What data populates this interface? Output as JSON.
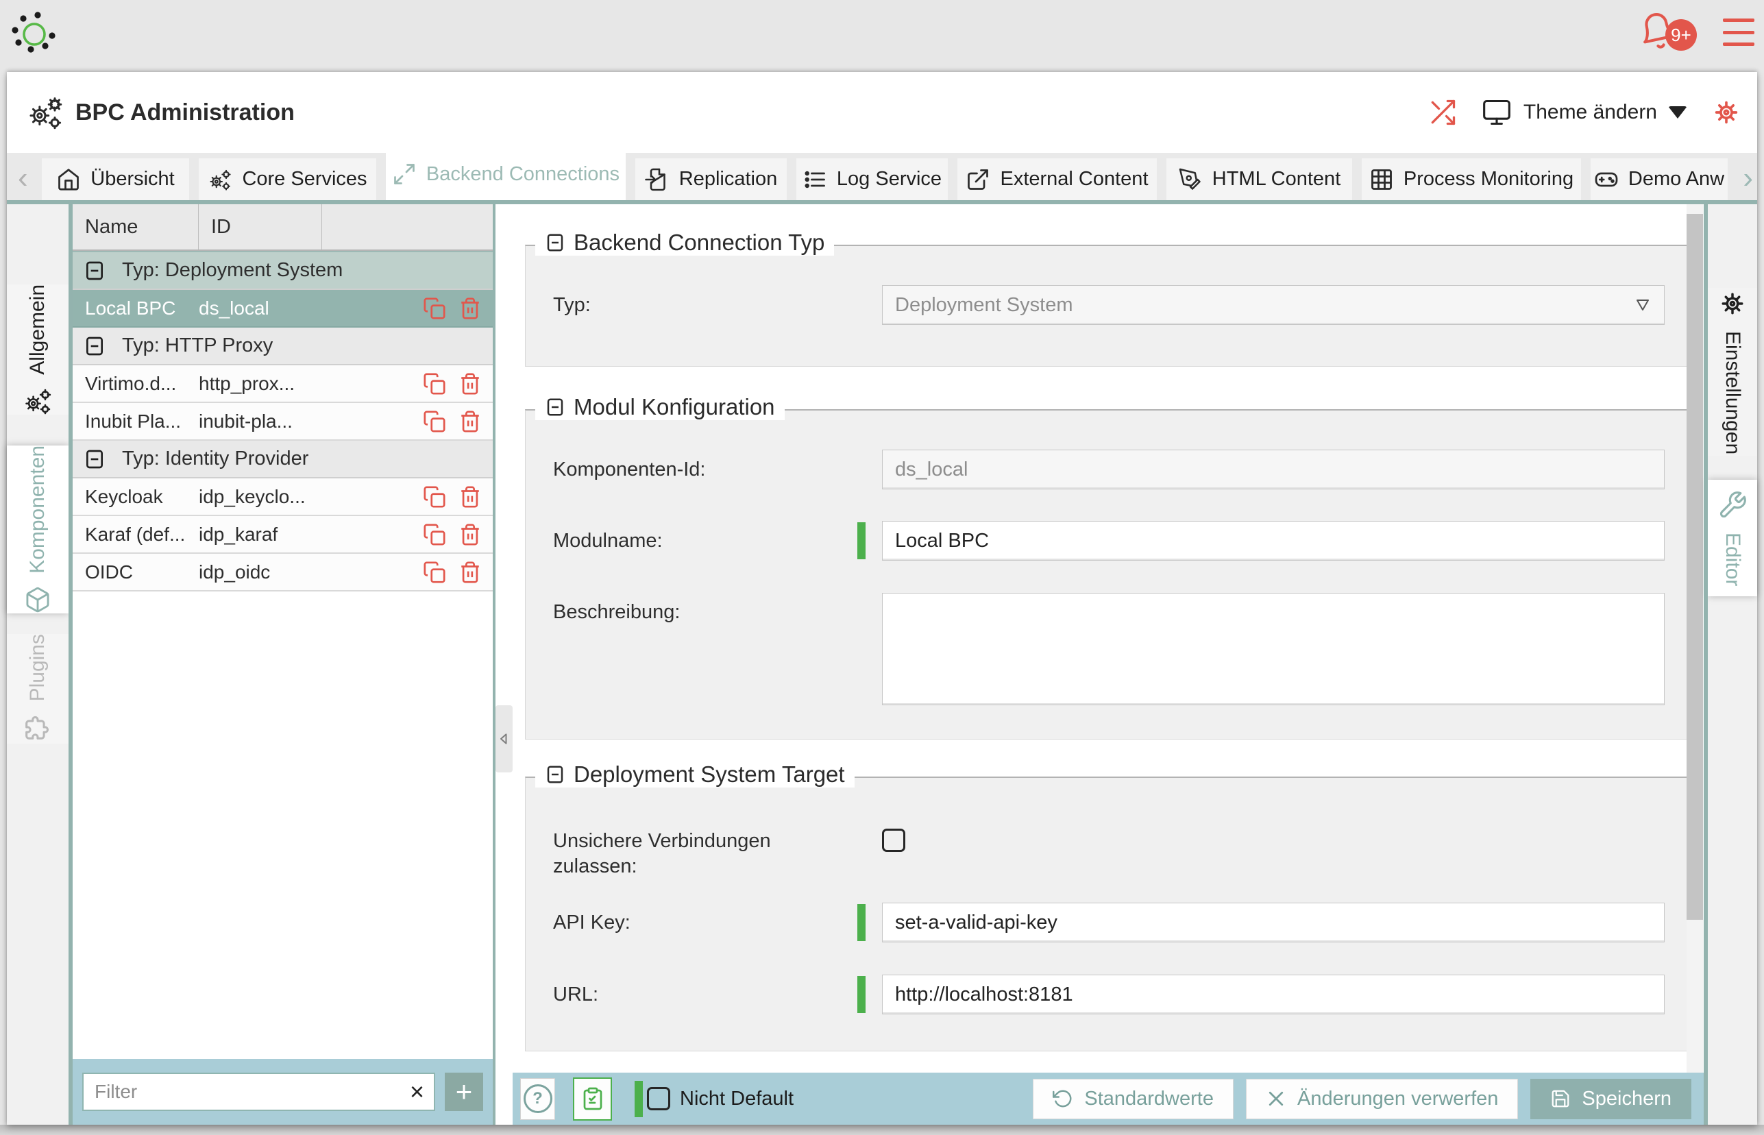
{
  "colors": {
    "accent_teal": "#8fb3ae",
    "accent_red": "#e2564b",
    "accent_green": "#4cb04c",
    "footer_blue": "#a9cdd7",
    "selected_row": "#93b4ae"
  },
  "glyphs": {
    "help": "?",
    "plus": "+",
    "clear": "×",
    "chev_left": "‹",
    "chev_right": "›"
  },
  "topbar": {
    "badge": "9+"
  },
  "titlebar": {
    "title": "BPC Administration",
    "theme": "Theme ändern"
  },
  "tabbar": {
    "tabs": [
      {
        "label": "Übersicht",
        "icon": "home"
      },
      {
        "label": "Core Services",
        "icon": "gears"
      },
      {
        "label": "Backend Connections",
        "icon": "expand-arrows",
        "active": true
      },
      {
        "label": "Replication",
        "icon": "document-arrow"
      },
      {
        "label": "Log Service",
        "icon": "list"
      },
      {
        "label": "External Content",
        "icon": "external-link"
      },
      {
        "label": "HTML Content",
        "icon": "pen"
      },
      {
        "label": "Process Monitoring",
        "icon": "table-grid"
      },
      {
        "label": "Demo Anw",
        "icon": "gamepad"
      }
    ]
  },
  "left_panel": {
    "tabs": [
      {
        "label": "Allgemein",
        "icon": "gears"
      },
      {
        "label": "Komponenten",
        "icon": "cube",
        "active": true
      },
      {
        "label": "Plugins",
        "icon": "puzzle",
        "disabled": true
      }
    ]
  },
  "right_panel": {
    "tabs": [
      {
        "label": "Einstellungen",
        "icon": "gear"
      },
      {
        "label": "Editor",
        "icon": "tools",
        "active": true
      }
    ]
  },
  "table": {
    "columns": [
      "Name",
      "ID"
    ],
    "filter_placeholder": "Filter",
    "rows": [
      {
        "type": "group",
        "label": "Typ: Deployment System",
        "highlight": true
      },
      {
        "type": "item",
        "name": "Local BPC",
        "id": "ds_local",
        "selected": true
      },
      {
        "type": "group",
        "label": "Typ: HTTP Proxy"
      },
      {
        "type": "item",
        "name": "Virtimo.d...",
        "id": "http_prox..."
      },
      {
        "type": "item",
        "name": "Inubit Pla...",
        "id": "inubit-pla..."
      },
      {
        "type": "group",
        "label": "Typ: Identity Provider"
      },
      {
        "type": "item",
        "name": "Keycloak",
        "id": "idp_keyclo..."
      },
      {
        "type": "item",
        "name": "Karaf (def...",
        "id": "idp_karaf"
      },
      {
        "type": "item",
        "name": "OIDC",
        "id": "idp_oidc"
      }
    ]
  },
  "form": {
    "sections": [
      {
        "legend": "Backend Connection Typ",
        "fields": [
          {
            "label": "Typ:",
            "value": "Deployment System",
            "disabled": true
          }
        ]
      },
      {
        "legend": "Modul Konfiguration",
        "fields": [
          {
            "label": "Komponenten-Id:",
            "value": "ds_local",
            "disabled": true
          },
          {
            "label": "Modulname:",
            "value": "Local BPC",
            "modified": true
          },
          {
            "label": "Beschreibung:",
            "value": ""
          }
        ]
      },
      {
        "legend": "Deployment System Target",
        "fields": [
          {
            "label": "Unsichere Verbindungen zulassen:",
            "checked": false
          },
          {
            "label": "API Key:",
            "value": "set-a-valid-api-key",
            "modified": true
          },
          {
            "label": "URL:",
            "value": "http://localhost:8181",
            "modified": true
          }
        ]
      }
    ]
  },
  "footer": {
    "nicht_default": "Nicht Default",
    "buttons": [
      {
        "label": "Standardwerte"
      },
      {
        "label": "Änderungen verwerfen"
      },
      {
        "label": "Speichern",
        "primary": true
      }
    ]
  }
}
